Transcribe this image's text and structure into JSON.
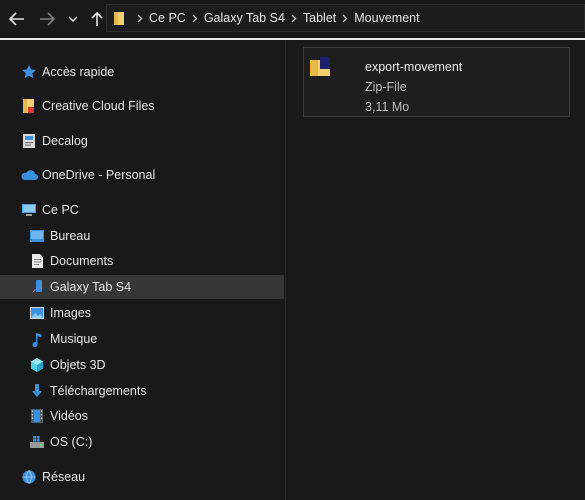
{
  "breadcrumb": [
    "Ce PC",
    "Galaxy Tab S4",
    "Tablet",
    "Mouvement"
  ],
  "sidebar": {
    "quick_access": "Accès rapide",
    "creative_cloud": "Creative Cloud Files",
    "decalog": "Decalog",
    "onedrive": "OneDrive - Personal",
    "this_pc": "Ce PC",
    "items": [
      "Bureau",
      "Documents",
      "Galaxy Tab S4",
      "Images",
      "Musique",
      "Objets 3D",
      "Téléchargements",
      "Vidéos",
      "OS (C:)"
    ],
    "network": "Réseau",
    "selected": "Galaxy Tab S4"
  },
  "file": {
    "name": "export-movement",
    "type": "Zip-File",
    "size": "3,11 Mo"
  },
  "colors": {
    "background": "#191919",
    "selection": "#363636",
    "folder": "#f4d06f",
    "accent": "#3a8fde"
  }
}
